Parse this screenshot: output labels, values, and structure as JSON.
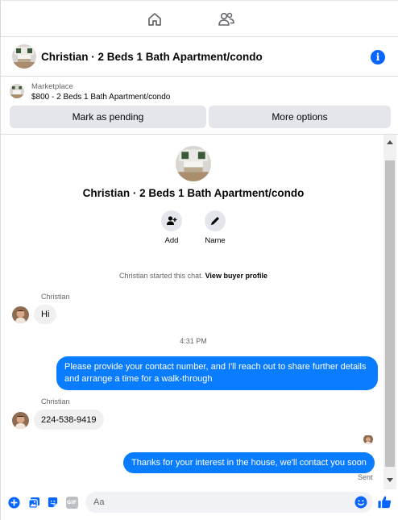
{
  "nav": {
    "home_icon": "home-icon",
    "people_icon": "people-icon"
  },
  "header": {
    "title": "Christian · 2 Beds 1 Bath Apartment/condo",
    "info_icon": "info-icon",
    "info_glyph": "i"
  },
  "marketplace": {
    "label": "Marketplace",
    "listing": "$800 - 2 Beds 1 Bath Apartment/condo",
    "pending_button": "Mark as pending",
    "more_button": "More options"
  },
  "conversation": {
    "title": "Christian · 2 Beds 1 Bath Apartment/condo",
    "actions": [
      {
        "label": "Add",
        "icon": "add-person-icon"
      },
      {
        "label": "Name",
        "icon": "pencil-icon"
      }
    ],
    "system_text": "Christian started this chat.",
    "system_link": "View buyer profile"
  },
  "messages": [
    {
      "sender": "Christian",
      "text": "Hi",
      "direction": "in"
    },
    {
      "timestamp": "4:31 PM"
    },
    {
      "text": "Please provide your contact number, and I'll reach out to share further details and arrange a time for a walk-through",
      "direction": "out"
    },
    {
      "sender": "Christian",
      "text": "224-538-9419",
      "direction": "in"
    },
    {
      "text": "Thanks for your interest in the house, we'll contact you soon",
      "direction": "out",
      "status": "Sent"
    }
  ],
  "composer": {
    "placeholder": "Aa",
    "icons": [
      "plus-icon",
      "photo-icon",
      "sticker-icon",
      "gif-icon",
      "emoji-icon",
      "thumbs-up-icon"
    ],
    "gif_text": "GIF"
  },
  "colors": {
    "accent": "#0866ff",
    "outgoing_bubble": "#0a7cff",
    "incoming_bubble": "#f0f0f0",
    "button_bg": "#e4e6eb"
  }
}
